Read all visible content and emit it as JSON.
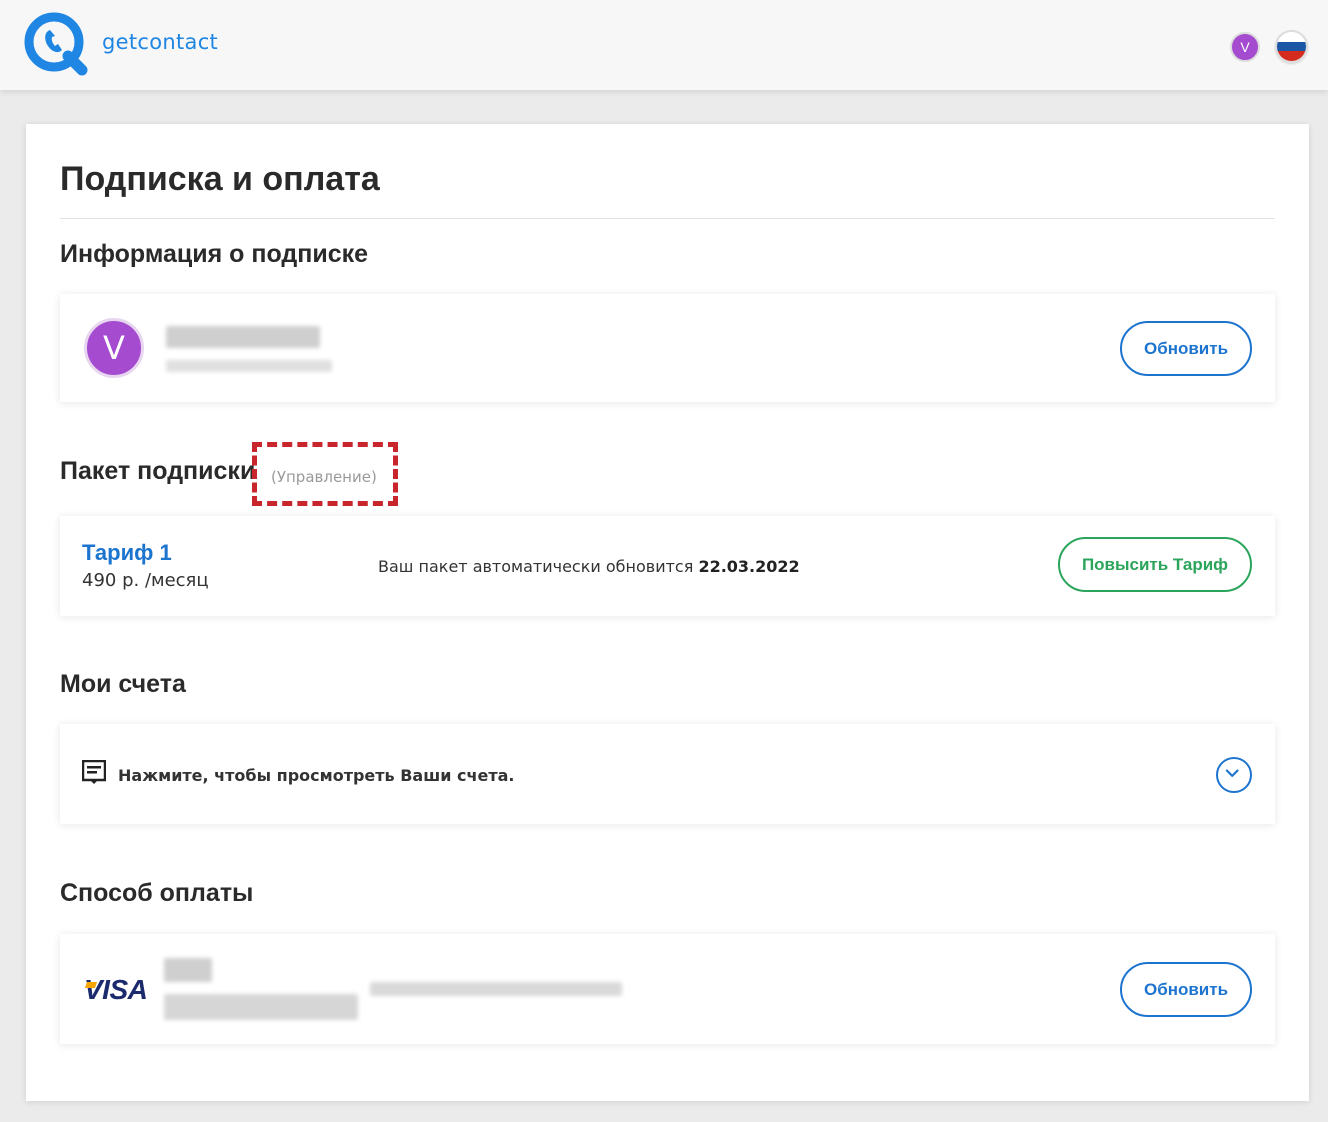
{
  "header": {
    "logo_text": "getcontact",
    "avatar_letter": "V",
    "flag_colors": [
      "#ffffff",
      "#1c57a5",
      "#d52b1e"
    ]
  },
  "page": {
    "title": "Подписка и оплата"
  },
  "subscription_info": {
    "title": "Информация о подписке",
    "avatar_letter": "V",
    "update_label": "Обновить"
  },
  "package": {
    "title": "Пакет подписки",
    "manage_label": "(Управление)",
    "plan_name": "Тариф 1",
    "plan_price": "490 р. /месяц",
    "renew_text": "Ваш пакет автоматически обновится",
    "renew_date": "22.03.2022",
    "upgrade_label": "Повысить Тариф"
  },
  "invoices": {
    "title": "Мои счета",
    "hint": "Нажмите, чтобы просмотреть Ваши счета."
  },
  "payment": {
    "title": "Способ оплаты",
    "card_brand": "VISA",
    "update_label": "Обновить"
  },
  "colors": {
    "brand_blue": "#1d74cf",
    "green": "#2ba55b",
    "avatar_purple": "#a54bd0",
    "highlight_red": "#c8262c"
  }
}
